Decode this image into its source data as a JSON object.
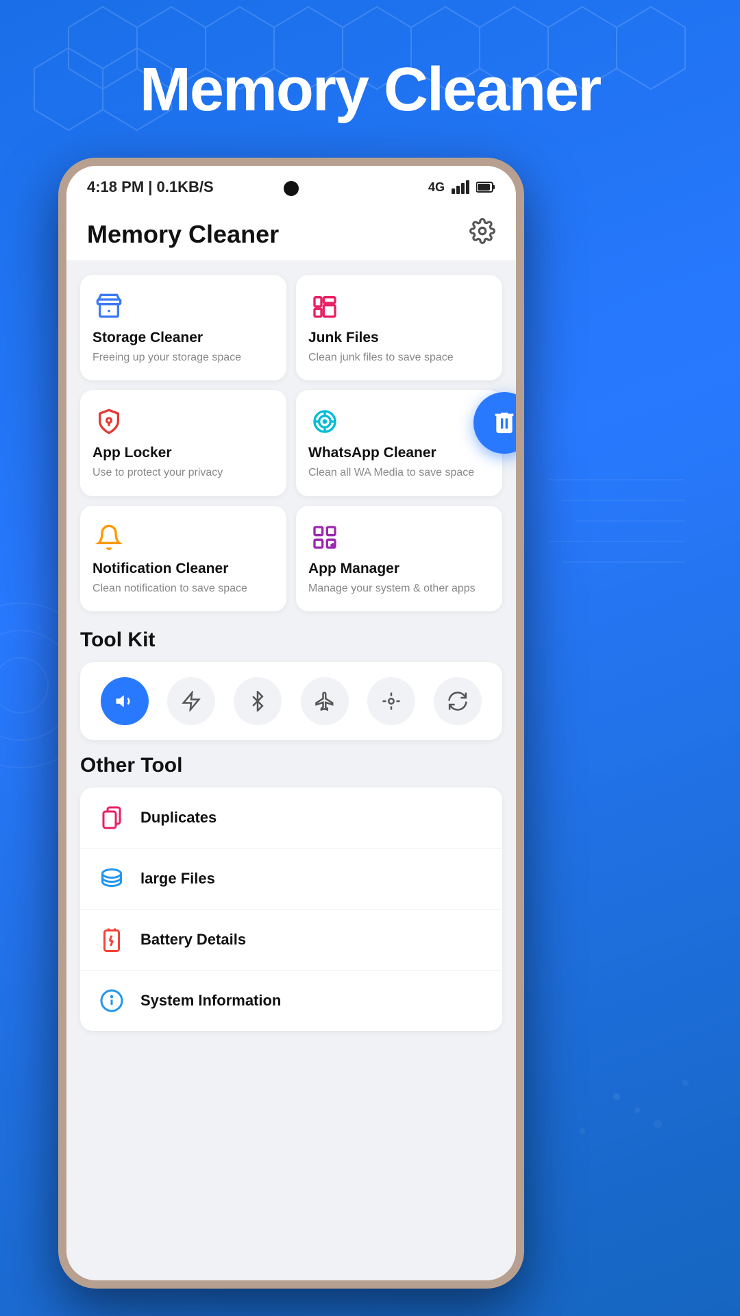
{
  "background": {
    "title": "Memory Cleaner"
  },
  "statusBar": {
    "time": "4:18 PM | 0.1KB/S",
    "network": "4G"
  },
  "appHeader": {
    "title": "Memory Cleaner"
  },
  "features": [
    {
      "id": "storage-cleaner",
      "name": "Storage Cleaner",
      "desc": "Freeing up your storage space",
      "iconType": "storage"
    },
    {
      "id": "junk-files",
      "name": "Junk Files",
      "desc": "Clean junk files to save space",
      "iconType": "junk"
    },
    {
      "id": "app-locker",
      "name": "App Locker",
      "desc": "Use to protect your privacy",
      "iconType": "locker"
    },
    {
      "id": "whatsapp-cleaner",
      "name": "WhatsApp Cleaner",
      "desc": "Clean all WA Media to save space",
      "iconType": "whatsapp"
    },
    {
      "id": "notification-cleaner",
      "name": "Notification Cleaner",
      "desc": "Clean notification to save space",
      "iconType": "notification"
    },
    {
      "id": "app-manager",
      "name": "App Manager",
      "desc": "Manage your system & other apps",
      "iconType": "appmanager"
    }
  ],
  "toolkit": {
    "sectionTitle": "Tool Kit",
    "buttons": [
      {
        "id": "volume",
        "label": "volume",
        "active": true
      },
      {
        "id": "flashlight",
        "label": "flashlight",
        "active": false
      },
      {
        "id": "bluetooth",
        "label": "bluetooth",
        "active": false
      },
      {
        "id": "airplane",
        "label": "airplane",
        "active": false
      },
      {
        "id": "location",
        "label": "location",
        "active": false
      },
      {
        "id": "rotate",
        "label": "rotate",
        "active": false
      }
    ]
  },
  "otherTool": {
    "sectionTitle": "Other Tool",
    "items": [
      {
        "id": "duplicates",
        "name": "Duplicates",
        "iconType": "duplicates"
      },
      {
        "id": "large-files",
        "name": "large Files",
        "iconType": "largefiles"
      },
      {
        "id": "battery-details",
        "name": "Battery Details",
        "iconType": "battery"
      },
      {
        "id": "system-information",
        "name": "System Information",
        "iconType": "sysinfo"
      }
    ]
  }
}
